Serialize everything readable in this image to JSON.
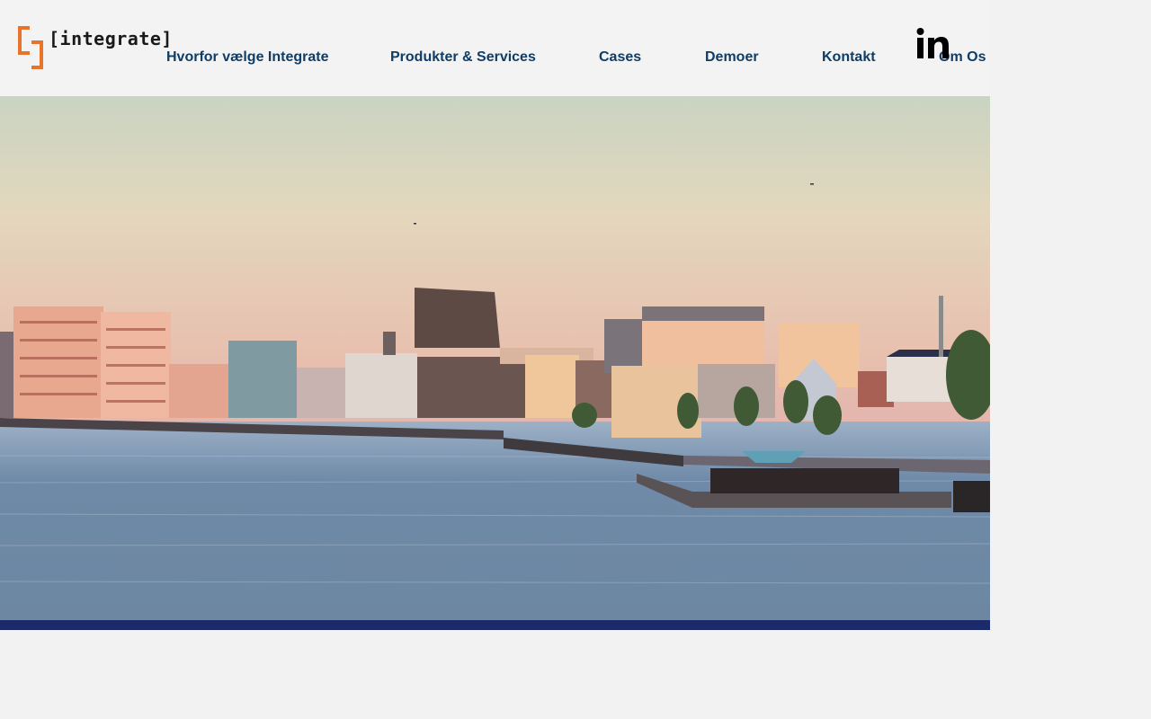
{
  "brand": {
    "logo_text": "[integrate]",
    "logo_color": "#e8732a"
  },
  "nav": {
    "items": [
      {
        "label": "Hvorfor vælge Integrate"
      },
      {
        "label": "Produkter & Services"
      },
      {
        "label": "Cases"
      },
      {
        "label": "Demoer"
      },
      {
        "label": "Kontakt"
      },
      {
        "label": "Om Os"
      }
    ]
  },
  "social": {
    "icon": "linkedin-icon"
  },
  "colors": {
    "nav_text": "#0f3d66",
    "hero_bar": "#1b2a6b",
    "background": "#f2f2f2"
  }
}
